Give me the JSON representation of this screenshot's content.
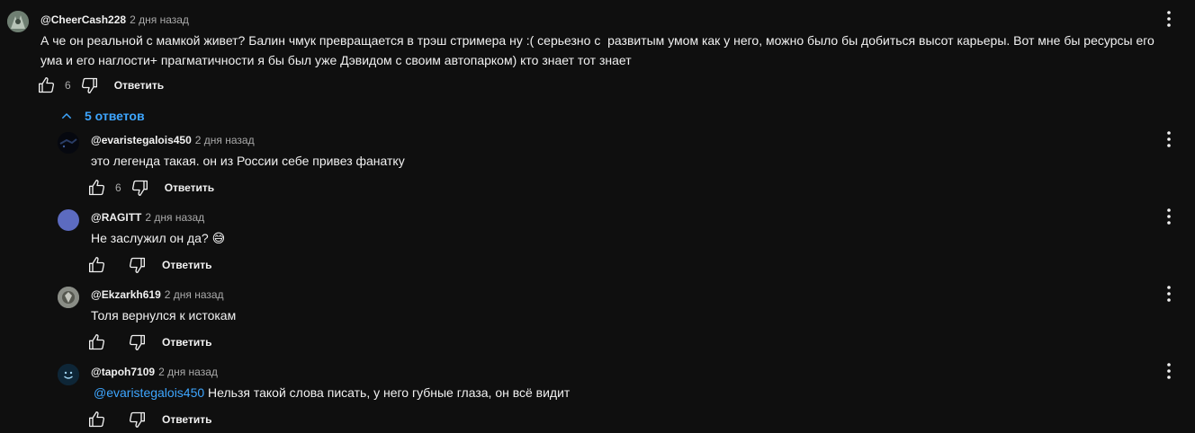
{
  "main_comment": {
    "author": "@CheerCash228",
    "time": "2 дня назад",
    "text": "А че он реальной с мамкой живет? Балин чмук превращается в трэш стримера ну :( серьезно с  развитым умом как у него, можно было бы добиться высот карьеры. Вот мне бы ресурсы его ума и его наглости+ прагматичности я бы был уже Дэвидом с своим автопарком) кто знает тот знает",
    "likes": "6",
    "reply_label": "Ответить"
  },
  "replies_toggle": {
    "label": "5 ответов",
    "icon": "chevron-up-icon"
  },
  "replies": [
    {
      "author": "@evaristegalois450",
      "time": "2 дня назад",
      "text": "это легенда такая. он из России себе привез фанатку",
      "likes": "6",
      "reply_label": "Ответить"
    },
    {
      "author": "@RAGITT",
      "time": "2 дня назад",
      "text": "Не заслужил он да? 😅",
      "likes": "",
      "reply_label": "Ответить"
    },
    {
      "author": "@Ekzarkh619",
      "time": "2 дня назад",
      "text": "Толя вернулся к истокам",
      "likes": "",
      "reply_label": "Ответить"
    },
    {
      "author": "@tapoh7109",
      "time": "2 дня назад",
      "mention": "@evaristegalois450",
      "text": " Нельзя такой слова писать, у него губные глаза, он всё видит",
      "likes": "",
      "reply_label": "Ответить"
    }
  ],
  "colors": {
    "background": "#0f0f0f",
    "text": "#f1f1f1",
    "secondary": "#aaaaaa",
    "link": "#3ea6ff",
    "avatar_ragitt": "#5c6bc0"
  }
}
